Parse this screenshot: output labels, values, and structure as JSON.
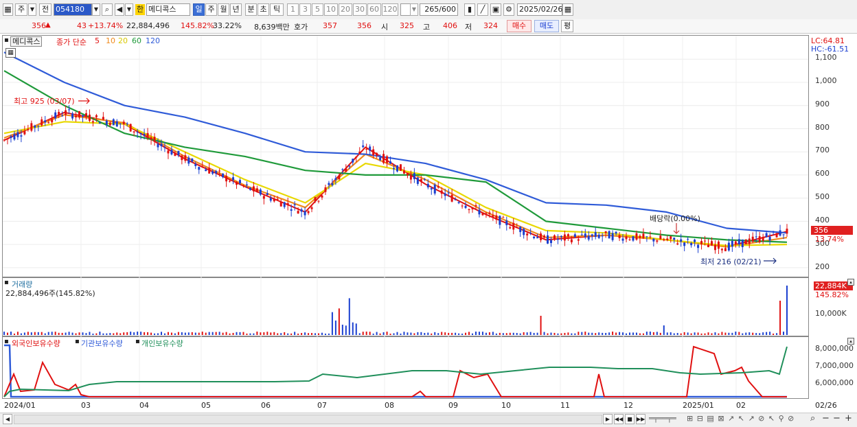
{
  "toolbar": {
    "market": "주",
    "range": "전",
    "code": "054180",
    "badge": "한",
    "name": "메디콕스",
    "periods": [
      "일",
      "주",
      "월",
      "년",
      "분",
      "초",
      "틱"
    ],
    "active_period": "일",
    "intervals": [
      "1",
      "3",
      "5",
      "10",
      "20",
      "30",
      "60",
      "120"
    ],
    "count": "265",
    "count_total": "/600",
    "date": "2025/02/26"
  },
  "quote": {
    "price": "356",
    "arrow": "▲",
    "change": "43",
    "change_pct": "+13.74%",
    "volume": "22,884,496",
    "volume_ratio": "145.82%",
    "turnover": "33.22%",
    "amount": "8,639백만",
    "hoga_label": "호가",
    "ask": "357",
    "bid": "356",
    "open_label": "시",
    "open": "325",
    "high_label": "고",
    "high": "406",
    "low_label": "저",
    "low": "324",
    "buy_label": "매수",
    "sell_label": "매도",
    "eval_label": "평"
  },
  "price_pane": {
    "title": "메디콕스",
    "ma_label": "종가 단순",
    "ma_periods": [
      "5",
      "10",
      "20",
      "60",
      "120"
    ],
    "ma_colors": [
      "#e01010",
      "#f08a1c",
      "#e8d800",
      "#1f9a3a",
      "#2f5bd8"
    ],
    "lc": "LC:64.81",
    "hc": "HC:-61.51",
    "y_ticks": [
      "1,100",
      "1,000",
      "900",
      "800",
      "700",
      "600",
      "500",
      "400",
      "300",
      "200"
    ],
    "price_tag": "356",
    "pct_tag": "13.74%",
    "high_note": "최고 925 (03/07)",
    "low_note": "최저 216 (02/21)",
    "dividend_note": "배당락(0.00%)"
  },
  "volume_pane": {
    "title": "거래량",
    "value": "22,884,496주(145.82%)",
    "tag": "22,884K",
    "pct": "145.82%",
    "tick": "10,000K"
  },
  "holding_pane": {
    "labels": [
      "외국인보유수량",
      "기관보유수량",
      "개인보유수량"
    ],
    "colors": [
      "#e01010",
      "#2f5bd8",
      "#1f8f5a"
    ],
    "ticks": [
      "8,000,000",
      "7,000,000",
      "6,000,000"
    ]
  },
  "x_axis": [
    "2024/01",
    "03",
    "04",
    "05",
    "06",
    "07",
    "08",
    "09",
    "10",
    "11",
    "12",
    "2025/01",
    "02",
    "02/26"
  ],
  "chart_data": {
    "type": "line",
    "title": "메디콕스",
    "xlabel": "",
    "ylabel": "",
    "ylim": [
      170,
      1160
    ],
    "x": [
      "2024/01",
      "03",
      "04",
      "05",
      "06",
      "07",
      "08",
      "09",
      "10",
      "11",
      "12",
      "2025/01",
      "02",
      "02/26"
    ],
    "series": [
      {
        "name": "5",
        "values": [
          750,
          870,
          820,
          670,
          550,
          440,
          720,
          560,
          430,
          320,
          340,
          320,
          290,
          356
        ]
      },
      {
        "name": "10",
        "values": [
          760,
          860,
          825,
          680,
          555,
          460,
          690,
          580,
          440,
          330,
          340,
          320,
          290,
          330
        ]
      },
      {
        "name": "20",
        "values": [
          780,
          830,
          820,
          700,
          580,
          480,
          650,
          600,
          460,
          360,
          350,
          320,
          295,
          300
        ]
      },
      {
        "name": "60",
        "values": [
          1050,
          900,
          780,
          720,
          680,
          620,
          600,
          600,
          570,
          400,
          370,
          340,
          320,
          310
        ]
      },
      {
        "name": "120",
        "values": [
          1130,
          1000,
          900,
          850,
          780,
          700,
          690,
          650,
          580,
          480,
          470,
          440,
          370,
          350
        ]
      }
    ]
  }
}
